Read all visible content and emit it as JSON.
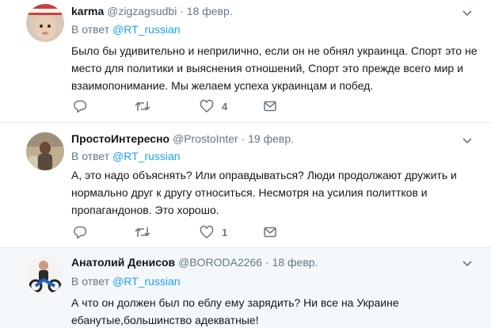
{
  "tweets": [
    {
      "name": "karma",
      "handle": "@zigzagsudbi",
      "separator": "·",
      "date": "18 февр.",
      "reply_prefix": "В ответ",
      "reply_to": "@RT_russian",
      "text": "Было бы удивительно и неприлично, если он не обнял украинца. Спорт это не место для политики и выяснения отношений, Спорт это прежде всего мир и взаимопонимание. Мы желаем успеха украинцам и побед.",
      "actions": {
        "reply_count": "",
        "retweet_count": "",
        "like_count": "4"
      }
    },
    {
      "name": "ПростоИнтересно",
      "handle": "@ProstoInter",
      "separator": "·",
      "date": "19 февр.",
      "reply_prefix": "В ответ",
      "reply_to": "@RT_russian",
      "text": "А, это надо объяснять? Или оправдываться? Люди продолжают дружить и нормально друг к другу относиться. Несмотря на усилия политтков и пропагандонов. Это хорошо.",
      "actions": {
        "reply_count": "",
        "retweet_count": "",
        "like_count": "1"
      }
    },
    {
      "name": "Анатолий Денисов",
      "handle": "@BORODA2266",
      "separator": "·",
      "date": "18 февр.",
      "reply_prefix": "В ответ",
      "reply_to": "@RT_russian",
      "text": "А что он должен был по еблу ему зарядить? Ни все на Украине ебанутые,большинство адекватные!"
    }
  ],
  "colors": {
    "link": "#1da1f2",
    "secondary_text": "#657786",
    "divider": "#e6ecf0",
    "highlight_bg": "#f5f8fa"
  },
  "icons": [
    "reply-icon",
    "retweet-icon",
    "like-icon",
    "direct-message-icon",
    "chevron-down-icon"
  ]
}
